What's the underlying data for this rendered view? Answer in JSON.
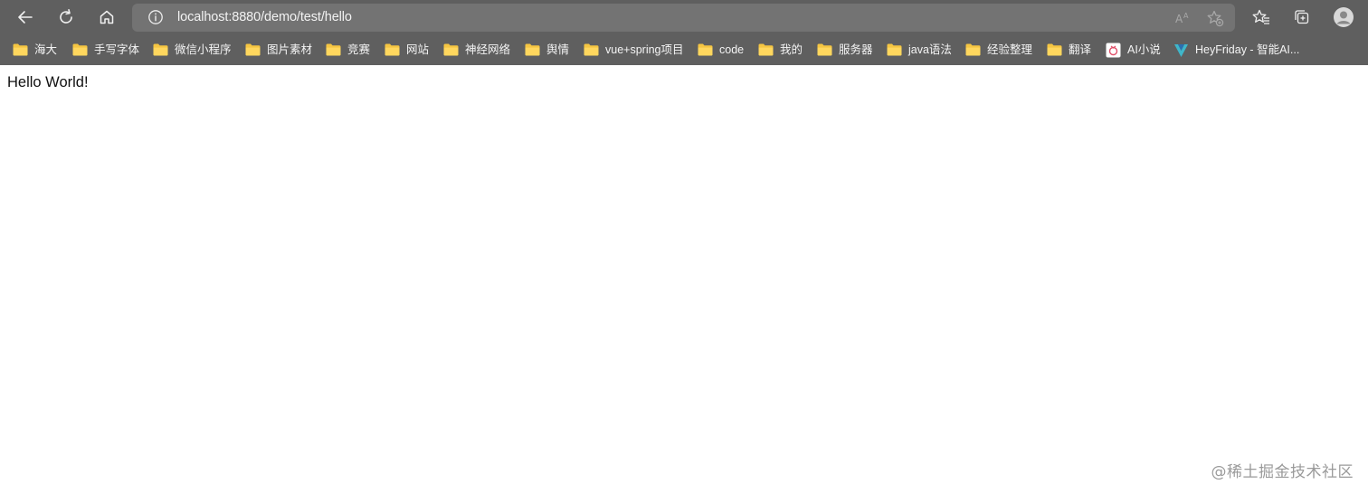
{
  "colors": {
    "chrome": "#5f5f5f",
    "address_bg": "#737373",
    "folder": "#f5c542",
    "text_light": "#f4f4f4"
  },
  "toolbar": {
    "back_icon": "arrow-left-icon",
    "refresh_icon": "refresh-icon",
    "home_icon": "home-icon",
    "url": "localhost:8880/demo/test/hello",
    "info_icon": "info-icon",
    "read_aloud_icon": "read-aloud-icon",
    "add_favorite_icon": "star-add-icon",
    "favorites_icon": "favorites-icon",
    "collections_icon": "collections-icon",
    "profile_icon": "profile-icon"
  },
  "bookmarks": [
    {
      "label": "海大",
      "icon": "folder-icon"
    },
    {
      "label": "手写字体",
      "icon": "folder-icon"
    },
    {
      "label": "微信小程序",
      "icon": "folder-icon"
    },
    {
      "label": "图片素材",
      "icon": "folder-icon"
    },
    {
      "label": "竞赛",
      "icon": "folder-icon"
    },
    {
      "label": "网站",
      "icon": "folder-icon"
    },
    {
      "label": "神经网络",
      "icon": "folder-icon"
    },
    {
      "label": "舆情",
      "icon": "folder-icon"
    },
    {
      "label": "vue+spring项目",
      "icon": "folder-icon"
    },
    {
      "label": "code",
      "icon": "folder-icon"
    },
    {
      "label": "我的",
      "icon": "folder-icon"
    },
    {
      "label": "服务器",
      "icon": "folder-icon"
    },
    {
      "label": "java语法",
      "icon": "folder-icon"
    },
    {
      "label": "经验整理",
      "icon": "folder-icon"
    },
    {
      "label": "翻译",
      "icon": "folder-icon"
    },
    {
      "label": "AI小说",
      "icon": "ai-novel-icon"
    },
    {
      "label": "HeyFriday - 智能AI...",
      "icon": "heyfriday-icon"
    }
  ],
  "page": {
    "body_text": "Hello World!"
  },
  "watermark": "@稀土掘金技术社区"
}
